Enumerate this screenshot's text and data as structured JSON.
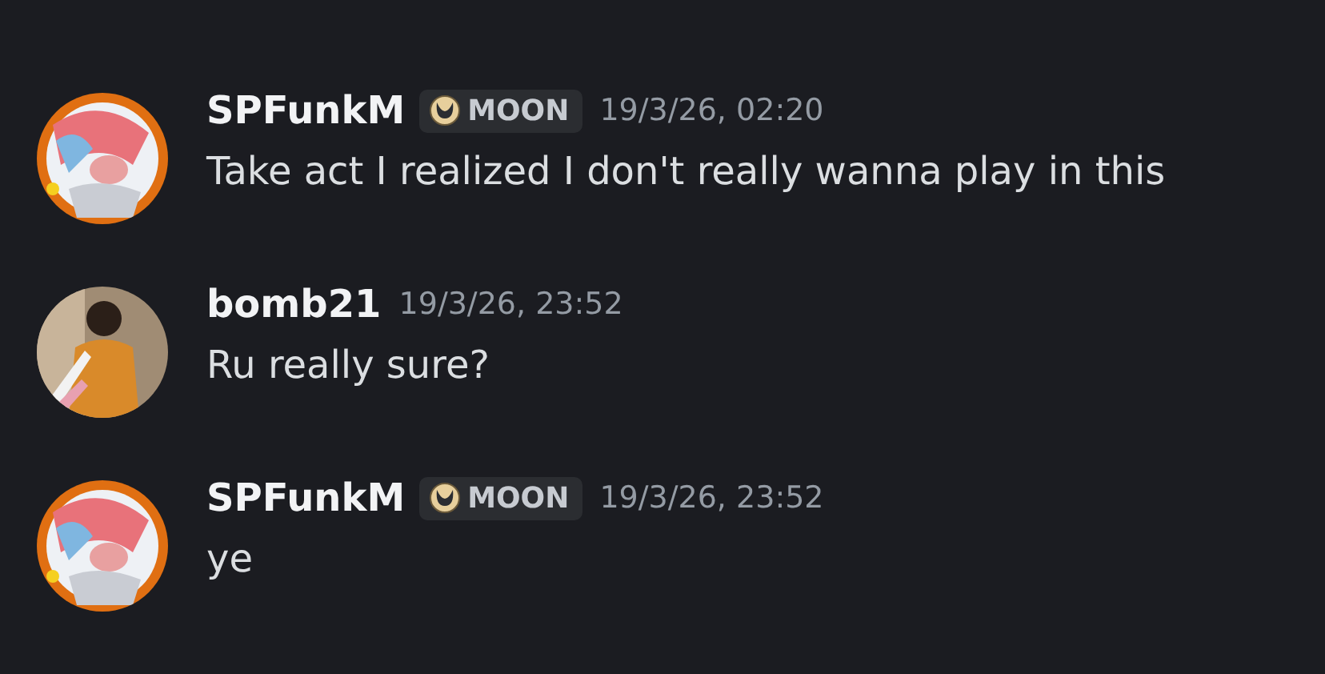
{
  "messages": [
    {
      "username": "SPFunkM",
      "badge": {
        "label": "MOON"
      },
      "timestamp": "19/3/26, 02:20",
      "text": "Take act I realized I don't really wanna play in this"
    },
    {
      "username": "bomb21",
      "timestamp": "19/3/26, 23:52",
      "text": "Ru really sure?"
    },
    {
      "username": "SPFunkM",
      "badge": {
        "label": "MOON"
      },
      "timestamp": "19/3/26, 23:52",
      "text": "ye"
    }
  ]
}
